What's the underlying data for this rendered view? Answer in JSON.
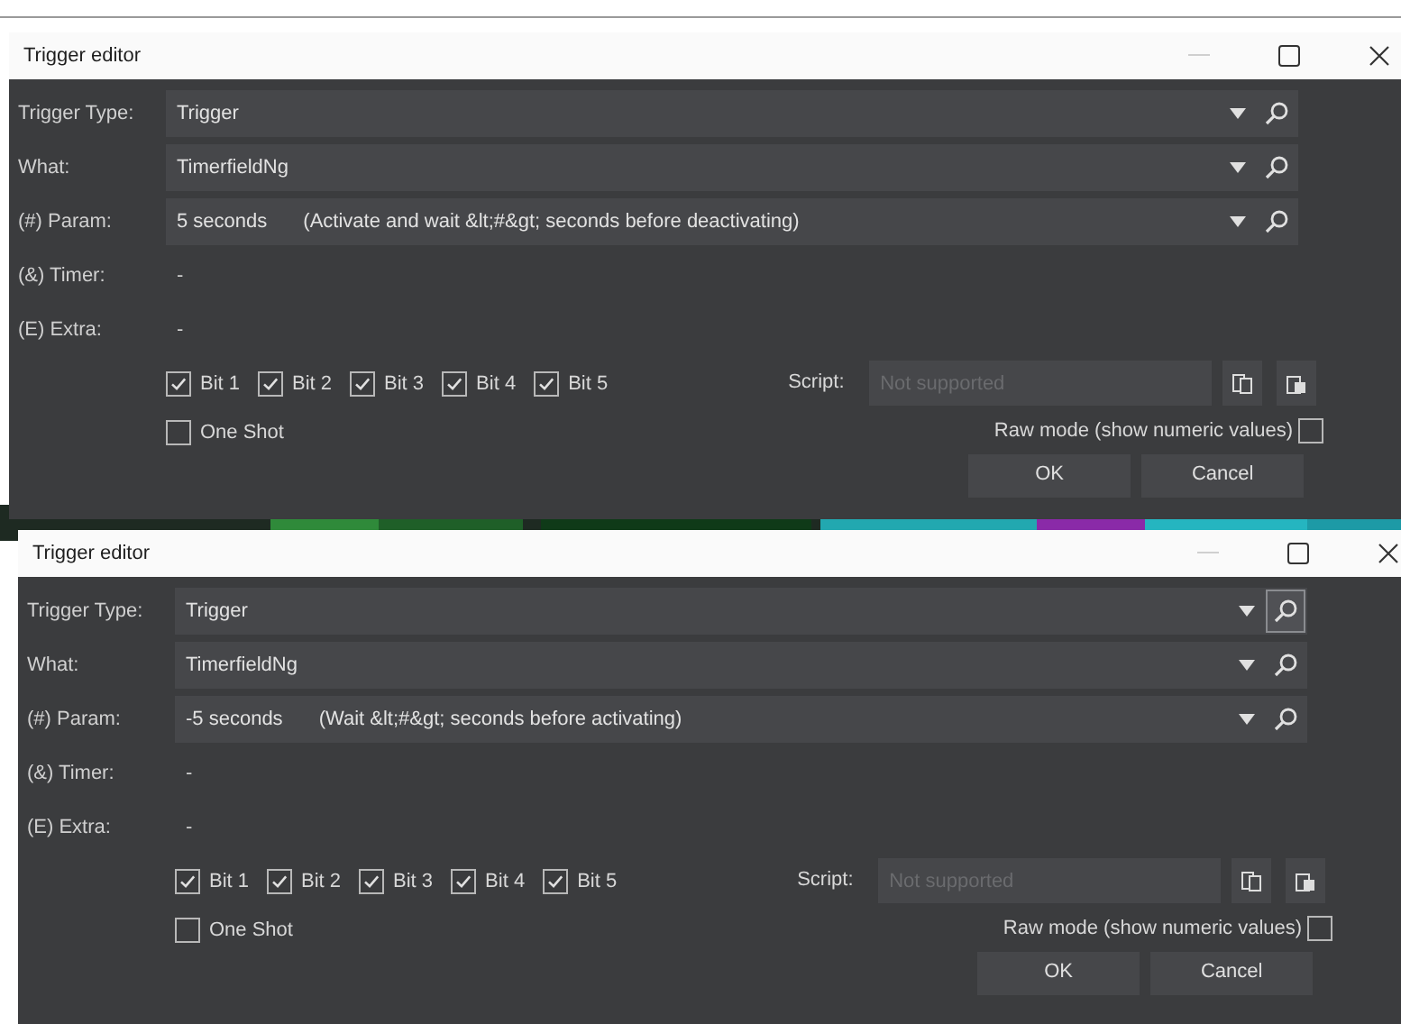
{
  "windows": [
    {
      "title": "Trigger editor",
      "fields": [
        {
          "kind": "dropdown",
          "label": "Trigger Type:",
          "value": "Trigger",
          "search_focused": false
        },
        {
          "kind": "dropdown",
          "label": "What:",
          "value": "TimerfieldNg",
          "search_focused": false
        },
        {
          "kind": "dropdown",
          "label": "(#) Param:",
          "value": "5 seconds",
          "note": "(Activate and wait &lt;#&gt; seconds before deactivating)",
          "search_focused": false
        },
        {
          "kind": "text",
          "label": "(&) Timer:",
          "value": "-"
        },
        {
          "kind": "text",
          "label": "(E) Extra:",
          "value": "-"
        }
      ],
      "bits": [
        {
          "label": "Bit 1",
          "checked": true
        },
        {
          "label": "Bit 2",
          "checked": true
        },
        {
          "label": "Bit 3",
          "checked": true
        },
        {
          "label": "Bit 4",
          "checked": true
        },
        {
          "label": "Bit 5",
          "checked": true
        }
      ],
      "one_shot": {
        "label": "One Shot",
        "checked": false
      },
      "script": {
        "label": "Script:",
        "placeholder": "Not supported",
        "disabled": true
      },
      "raw_mode": {
        "label": "Raw mode (show numeric values)",
        "checked": false
      },
      "buttons": [
        "OK",
        "Cancel"
      ]
    },
    {
      "title": "Trigger editor",
      "fields": [
        {
          "kind": "dropdown",
          "label": "Trigger Type:",
          "value": "Trigger",
          "search_focused": true
        },
        {
          "kind": "dropdown",
          "label": "What:",
          "value": "TimerfieldNg",
          "search_focused": false
        },
        {
          "kind": "dropdown",
          "label": "(#) Param:",
          "value": "-5 seconds",
          "note": "(Wait &lt;#&gt; seconds before activating)",
          "search_focused": false
        },
        {
          "kind": "text",
          "label": "(&) Timer:",
          "value": "-"
        },
        {
          "kind": "text",
          "label": "(E) Extra:",
          "value": "-"
        }
      ],
      "bits": [
        {
          "label": "Bit 1",
          "checked": true
        },
        {
          "label": "Bit 2",
          "checked": true
        },
        {
          "label": "Bit 3",
          "checked": true
        },
        {
          "label": "Bit 4",
          "checked": true
        },
        {
          "label": "Bit 5",
          "checked": true
        }
      ],
      "one_shot": {
        "label": "One Shot",
        "checked": false
      },
      "script": {
        "label": "Script:",
        "placeholder": "Not supported",
        "disabled": true
      },
      "raw_mode": {
        "label": "Raw mode (show numeric values)",
        "checked": false
      },
      "buttons": [
        "OK",
        "Cancel"
      ]
    }
  ]
}
